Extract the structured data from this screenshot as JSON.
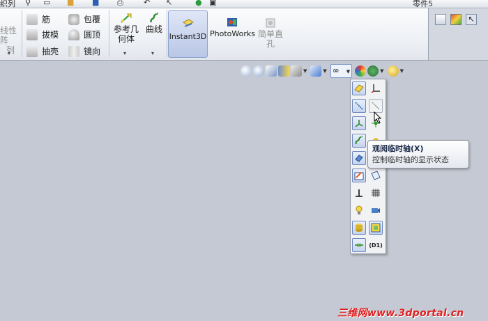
{
  "top_strip": {
    "left_fragment": "织列",
    "right_fragment": "零件5"
  },
  "ribbon": {
    "linear_pattern_label_1": "线性阵",
    "linear_pattern_label_2": "列",
    "rib_label": "筋",
    "draft_label": "拔模",
    "shell_label": "抽壳",
    "wrap_label": "包覆",
    "dome_label": "圆顶",
    "mirror_label": "镜向",
    "ref_geometry_label_1": "参考几",
    "ref_geometry_label_2": "何体",
    "curves_label": "曲线",
    "instant3d_label": "Instant3D",
    "photoworks_label": "PhotoWorks",
    "simple_hole_label_1": "简单直",
    "simple_hole_label_2": "孔"
  },
  "palette": {
    "dimension_label": "(D1)"
  },
  "tooltip": {
    "title": "观阅临时轴(X)",
    "description": "控制临时轴的显示状态"
  },
  "watermark": {
    "text": "三维网www.3dportal.cn"
  },
  "colors": {
    "viewport_bg": "#c4c9d3",
    "active_button": "#b9c7e6",
    "watermark": "#e02020"
  }
}
